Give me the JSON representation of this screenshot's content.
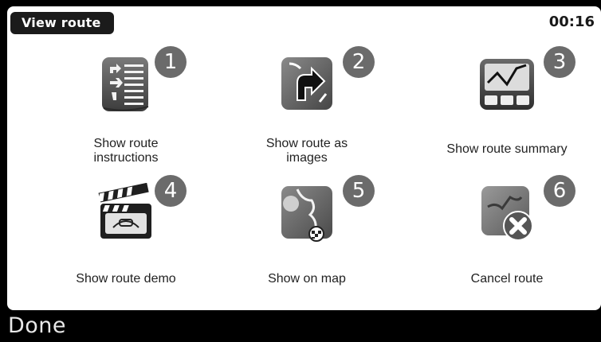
{
  "header": {
    "title": "View route",
    "clock": "00:16"
  },
  "tiles": [
    {
      "number": "1",
      "label": "Show route\ninstructions",
      "icon": "route-instructions-icon"
    },
    {
      "number": "2",
      "label": "Show route as\nimages",
      "icon": "route-images-icon"
    },
    {
      "number": "3",
      "label": "Show route summary",
      "icon": "route-summary-icon"
    },
    {
      "number": "4",
      "label": "Show route demo",
      "icon": "route-demo-icon"
    },
    {
      "number": "5",
      "label": "Show on map",
      "icon": "show-on-map-icon"
    },
    {
      "number": "6",
      "label": "Cancel route",
      "icon": "cancel-route-icon"
    }
  ],
  "footer": {
    "done_label": "Done"
  }
}
